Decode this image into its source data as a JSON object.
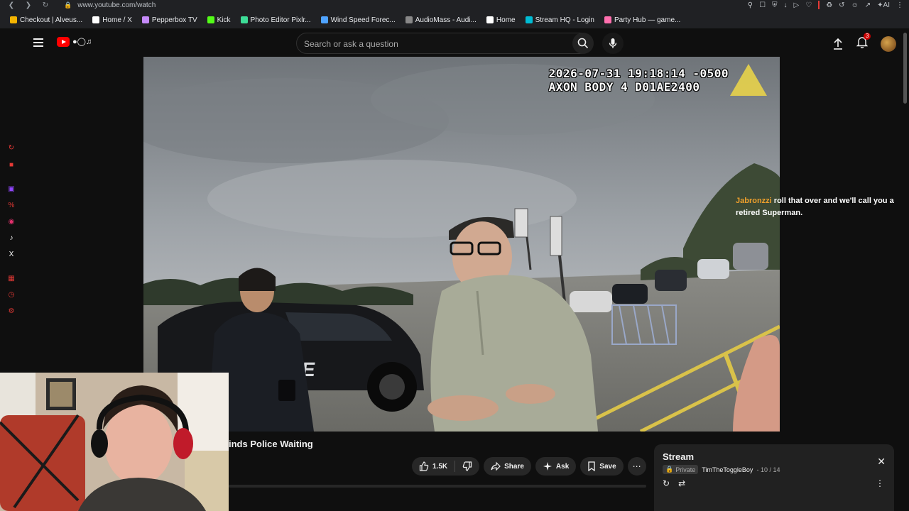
{
  "browser": {
    "url": "www.youtube.com/watch",
    "bookmarks": [
      {
        "label": "Checkout | Alveus...",
        "color": "#f4b400"
      },
      {
        "label": "Home / X",
        "color": "#ffffff"
      },
      {
        "label": "Pepperbox TV",
        "color": "#c58af9"
      },
      {
        "label": "Kick",
        "color": "#53fc18"
      },
      {
        "label": "Photo Editor Pixlr...",
        "color": "#3ddc97"
      },
      {
        "label": "Wind Speed Forec...",
        "color": "#4fa3ff"
      },
      {
        "label": "AudioMass - Audi...",
        "color": "#888888"
      },
      {
        "label": "Home",
        "color": "#ffffff"
      },
      {
        "label": "Stream HQ - Login",
        "color": "#00bcd4"
      },
      {
        "label": "Party Hub — game...",
        "color": "#ff6fae"
      }
    ]
  },
  "header": {
    "search_placeholder": "Search or ask a question",
    "notification_count": "3"
  },
  "video": {
    "osd_line1": "2026-07-31 19:18:14 -0500",
    "osd_line2": "AXON BODY 4 D01AE2400",
    "title": "inds Police Waiting"
  },
  "chat": {
    "user": "Jabronzzi",
    "message": "roll that over and we'll call you a retired Superman."
  },
  "actions": {
    "likes": "1.5K",
    "share": "Share",
    "ask": "Ask",
    "save": "Save"
  },
  "playlist": {
    "title": "Stream",
    "privacy": "Private",
    "owner": "TimTheToggleBoy",
    "count": "10 / 14"
  }
}
